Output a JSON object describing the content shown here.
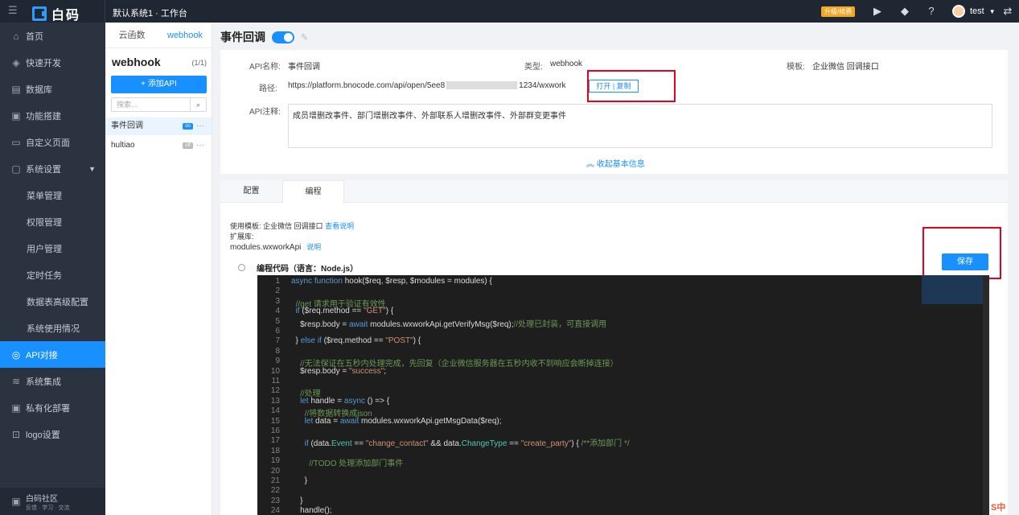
{
  "topbar": {
    "logo_text": "白码",
    "breadcrumb": "默认系统1 · 工作台",
    "upgrade_label": "升级/续费",
    "user_name": "test"
  },
  "sidebar": {
    "items": [
      {
        "label": "首页",
        "icon": "home-icon"
      },
      {
        "label": "快速开发",
        "icon": "cube-icon"
      },
      {
        "label": "数据库",
        "icon": "database-icon"
      },
      {
        "label": "功能搭建",
        "icon": "build-icon"
      },
      {
        "label": "自定义页面",
        "icon": "page-icon"
      },
      {
        "label": "系统设置",
        "icon": "monitor-icon"
      },
      {
        "label": "菜单管理"
      },
      {
        "label": "权限管理"
      },
      {
        "label": "用户管理"
      },
      {
        "label": "定时任务"
      },
      {
        "label": "数据表高级配置"
      },
      {
        "label": "系统使用情况"
      },
      {
        "label": "API对接",
        "icon": "api-icon"
      },
      {
        "label": "系统集成",
        "icon": "layers-icon"
      },
      {
        "label": "私有化部署",
        "icon": "server-icon"
      },
      {
        "label": "logo设置",
        "icon": "logo-icon"
      }
    ],
    "community_title": "白码社区",
    "community_sub": "反馈 · 学习 · 交流"
  },
  "api_panel": {
    "tabs": [
      "云函数",
      "webhook"
    ],
    "title": "webhook",
    "count": "(1/1)",
    "add_button": "+ 添加API",
    "search_placeholder": "搜索...",
    "rows": [
      {
        "name": "事件回调",
        "status": "on"
      },
      {
        "name": "hultiao",
        "status": "off"
      }
    ]
  },
  "detail": {
    "title": "事件回调",
    "api_name_label": "API名称:",
    "api_name": "事件回调",
    "type_label": "类型:",
    "type": "webhook",
    "template_label": "模板:",
    "template": "企业微信 回调接口",
    "path_label": "路径:",
    "path_prefix": "https://platform.bnocode.com/api/open/5ee8",
    "path_suffix": "1234/wxwork",
    "open_label": "打开",
    "copy_label": "复制",
    "comment_label": "API注释:",
    "comment": "成员增删改事件、部门增删改事件、外部联系人增删改事件、外部群变更事件",
    "collapse_label": "收起基本信息"
  },
  "tabs": [
    "配置",
    "编程"
  ],
  "coding": {
    "use_template_label": "使用模板:",
    "use_template": "企业微信 回调接口",
    "view_doc": "查看说明",
    "ext_label": "扩展库:",
    "ext_value": "modules.wxworkApi",
    "ext_doc": "说明",
    "code_title": "编程代码（语言：Node.js）",
    "save_label": "保存"
  },
  "code_lines": [
    "async function hook($req, $resp, $modules = modules) {",
    "",
    "  //get 请求用于验证有效性",
    "  if ($req.method == \"GET\") {",
    "    $resp.body = await modules.wxworkApi.getVerifyMsg($req);//处理已封装，可直接调用",
    "",
    "  } else if ($req.method == \"POST\") {",
    "",
    "    //无法保证在五秒内处理完成，先回复（企业微信服务器在五秒内收不到响应会断掉连接）",
    "    $resp.body = \"success\";",
    "",
    "    //处理",
    "    let handle = async () => {",
    "      //将数据转换成json",
    "      let data = await modules.wxworkApi.getMsgData($req);",
    "",
    "      if (data.Event == \"change_contact\" && data.ChangeType == \"create_party\") { /**添加部门 */",
    "",
    "        //TODO 处理添加部门事件",
    "",
    "      }",
    "",
    "    }",
    "    handle();"
  ]
}
